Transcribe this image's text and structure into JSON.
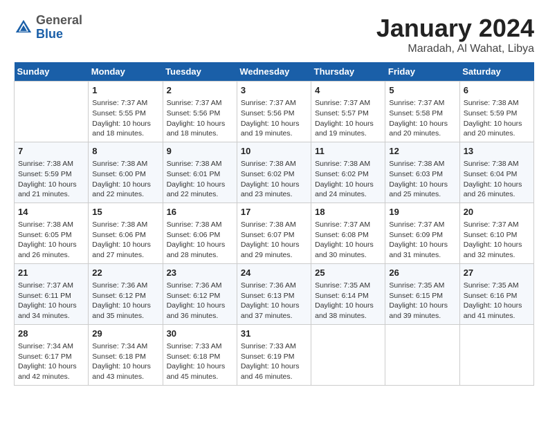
{
  "header": {
    "logo_general": "General",
    "logo_blue": "Blue",
    "month_title": "January 2024",
    "location": "Maradah, Al Wahat, Libya"
  },
  "days_of_week": [
    "Sunday",
    "Monday",
    "Tuesday",
    "Wednesday",
    "Thursday",
    "Friday",
    "Saturday"
  ],
  "weeks": [
    [
      {
        "day": "",
        "info": ""
      },
      {
        "day": "1",
        "info": "Sunrise: 7:37 AM\nSunset: 5:55 PM\nDaylight: 10 hours\nand 18 minutes."
      },
      {
        "day": "2",
        "info": "Sunrise: 7:37 AM\nSunset: 5:56 PM\nDaylight: 10 hours\nand 18 minutes."
      },
      {
        "day": "3",
        "info": "Sunrise: 7:37 AM\nSunset: 5:56 PM\nDaylight: 10 hours\nand 19 minutes."
      },
      {
        "day": "4",
        "info": "Sunrise: 7:37 AM\nSunset: 5:57 PM\nDaylight: 10 hours\nand 19 minutes."
      },
      {
        "day": "5",
        "info": "Sunrise: 7:37 AM\nSunset: 5:58 PM\nDaylight: 10 hours\nand 20 minutes."
      },
      {
        "day": "6",
        "info": "Sunrise: 7:38 AM\nSunset: 5:59 PM\nDaylight: 10 hours\nand 20 minutes."
      }
    ],
    [
      {
        "day": "7",
        "info": "Sunrise: 7:38 AM\nSunset: 5:59 PM\nDaylight: 10 hours\nand 21 minutes."
      },
      {
        "day": "8",
        "info": "Sunrise: 7:38 AM\nSunset: 6:00 PM\nDaylight: 10 hours\nand 22 minutes."
      },
      {
        "day": "9",
        "info": "Sunrise: 7:38 AM\nSunset: 6:01 PM\nDaylight: 10 hours\nand 22 minutes."
      },
      {
        "day": "10",
        "info": "Sunrise: 7:38 AM\nSunset: 6:02 PM\nDaylight: 10 hours\nand 23 minutes."
      },
      {
        "day": "11",
        "info": "Sunrise: 7:38 AM\nSunset: 6:02 PM\nDaylight: 10 hours\nand 24 minutes."
      },
      {
        "day": "12",
        "info": "Sunrise: 7:38 AM\nSunset: 6:03 PM\nDaylight: 10 hours\nand 25 minutes."
      },
      {
        "day": "13",
        "info": "Sunrise: 7:38 AM\nSunset: 6:04 PM\nDaylight: 10 hours\nand 26 minutes."
      }
    ],
    [
      {
        "day": "14",
        "info": "Sunrise: 7:38 AM\nSunset: 6:05 PM\nDaylight: 10 hours\nand 26 minutes."
      },
      {
        "day": "15",
        "info": "Sunrise: 7:38 AM\nSunset: 6:06 PM\nDaylight: 10 hours\nand 27 minutes."
      },
      {
        "day": "16",
        "info": "Sunrise: 7:38 AM\nSunset: 6:06 PM\nDaylight: 10 hours\nand 28 minutes."
      },
      {
        "day": "17",
        "info": "Sunrise: 7:38 AM\nSunset: 6:07 PM\nDaylight: 10 hours\nand 29 minutes."
      },
      {
        "day": "18",
        "info": "Sunrise: 7:37 AM\nSunset: 6:08 PM\nDaylight: 10 hours\nand 30 minutes."
      },
      {
        "day": "19",
        "info": "Sunrise: 7:37 AM\nSunset: 6:09 PM\nDaylight: 10 hours\nand 31 minutes."
      },
      {
        "day": "20",
        "info": "Sunrise: 7:37 AM\nSunset: 6:10 PM\nDaylight: 10 hours\nand 32 minutes."
      }
    ],
    [
      {
        "day": "21",
        "info": "Sunrise: 7:37 AM\nSunset: 6:11 PM\nDaylight: 10 hours\nand 34 minutes."
      },
      {
        "day": "22",
        "info": "Sunrise: 7:36 AM\nSunset: 6:12 PM\nDaylight: 10 hours\nand 35 minutes."
      },
      {
        "day": "23",
        "info": "Sunrise: 7:36 AM\nSunset: 6:12 PM\nDaylight: 10 hours\nand 36 minutes."
      },
      {
        "day": "24",
        "info": "Sunrise: 7:36 AM\nSunset: 6:13 PM\nDaylight: 10 hours\nand 37 minutes."
      },
      {
        "day": "25",
        "info": "Sunrise: 7:35 AM\nSunset: 6:14 PM\nDaylight: 10 hours\nand 38 minutes."
      },
      {
        "day": "26",
        "info": "Sunrise: 7:35 AM\nSunset: 6:15 PM\nDaylight: 10 hours\nand 39 minutes."
      },
      {
        "day": "27",
        "info": "Sunrise: 7:35 AM\nSunset: 6:16 PM\nDaylight: 10 hours\nand 41 minutes."
      }
    ],
    [
      {
        "day": "28",
        "info": "Sunrise: 7:34 AM\nSunset: 6:17 PM\nDaylight: 10 hours\nand 42 minutes."
      },
      {
        "day": "29",
        "info": "Sunrise: 7:34 AM\nSunset: 6:18 PM\nDaylight: 10 hours\nand 43 minutes."
      },
      {
        "day": "30",
        "info": "Sunrise: 7:33 AM\nSunset: 6:18 PM\nDaylight: 10 hours\nand 45 minutes."
      },
      {
        "day": "31",
        "info": "Sunrise: 7:33 AM\nSunset: 6:19 PM\nDaylight: 10 hours\nand 46 minutes."
      },
      {
        "day": "",
        "info": ""
      },
      {
        "day": "",
        "info": ""
      },
      {
        "day": "",
        "info": ""
      }
    ]
  ]
}
